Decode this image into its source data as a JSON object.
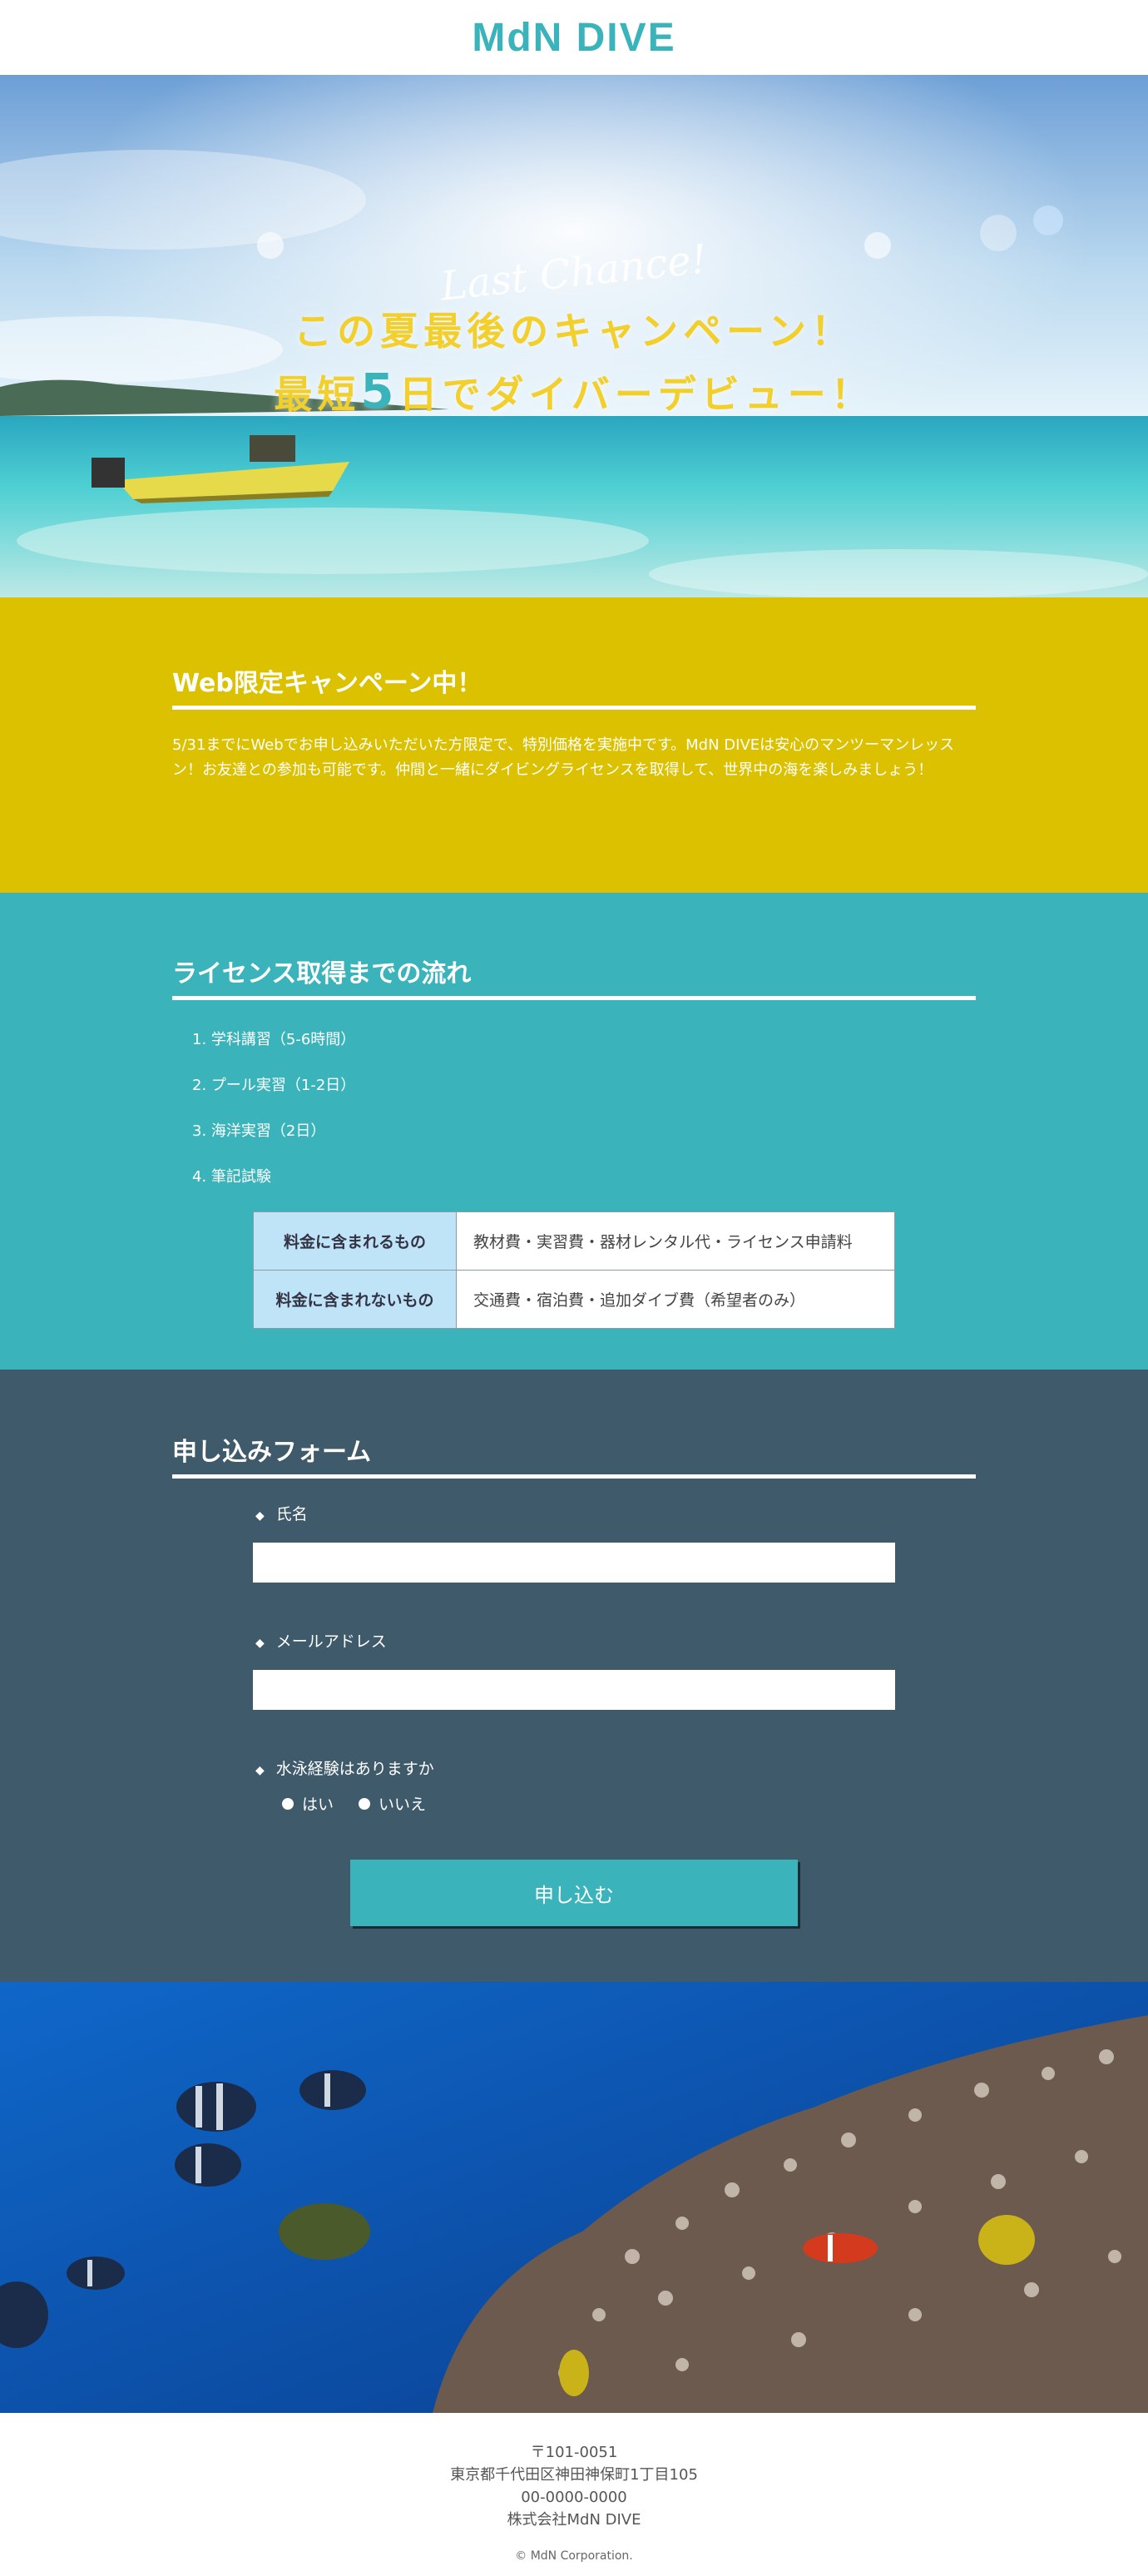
{
  "header": {
    "logo": "MdN DIVE"
  },
  "hero": {
    "script": "Last Chance!",
    "line1": "この夏最後のキャンペーン！",
    "line2_pre": "最短",
    "line2_num": "5",
    "line2_post": "日でダイバーデビュー！"
  },
  "campaign": {
    "title": "Web限定キャンペーン中！",
    "text": "5/31までにWebでお申し込みいただいた方限定で、特別価格を実施中です。MdN DIVEは安心のマンツーマンレッスン！お友達との参加も可能です。仲間と一緒にダイビングライセンスを取得して、世界中の海を楽しみましょう！"
  },
  "flow": {
    "title": "ライセンス取得までの流れ",
    "steps": [
      "1. 学科講習（5-6時間）",
      "2. プール実習（1-2日）",
      "3. 海洋実習（2日）",
      "4. 筆記試験"
    ],
    "table": [
      {
        "head": "料金に含まれるもの",
        "value": "教材費・実習費・器材レンタル代・ライセンス申請料"
      },
      {
        "head": "料金に含まれないもの",
        "value": "交通費・宿泊費・追加ダイブ費（希望者のみ）"
      }
    ]
  },
  "form": {
    "title": "申し込みフォーム",
    "name_label": "氏名",
    "email_label": "メールアドレス",
    "swim_label": "水泳経験はありますか",
    "opt_yes": "はい",
    "opt_no": "いいえ",
    "submit": "申し込む"
  },
  "footer": {
    "postal": "〒101-0051",
    "address": "東京都千代田区神田神保町1丁目105",
    "phone": "00-0000-0000",
    "company": "株式会社MdN DIVE",
    "copyright": "© MdN Corporation."
  },
  "colors": {
    "teal": "#3ab4ba",
    "mustard": "#dcc100",
    "slate": "#3f5a6a"
  }
}
